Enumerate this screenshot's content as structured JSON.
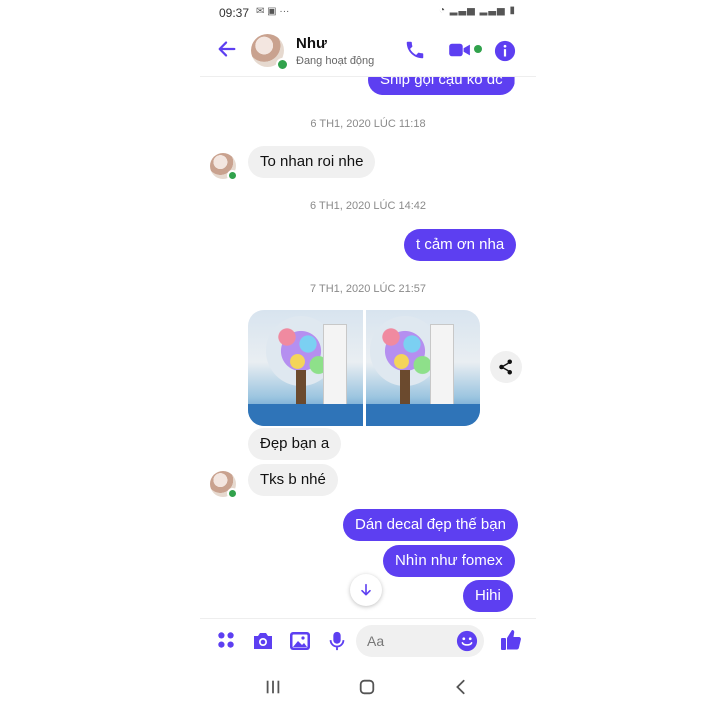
{
  "status_bar": {
    "time": "09:37"
  },
  "header": {
    "name": "Như",
    "status": "Đang hoạt động"
  },
  "messages": {
    "top_partial": "Ship gọi cậu ko dc",
    "ts1": "6 TH1, 2020 LÚC 11:18",
    "in1": "To nhan roi nhe",
    "ts2": "6 TH1, 2020 LÚC 14:42",
    "out1": "t cảm ơn nha",
    "ts3": "7 TH1, 2020 LÚC 21:57",
    "in2": "Đẹp bạn a",
    "in3": "Tks b nhé",
    "out2": "Dán decal đẹp thế bạn",
    "out3": "Nhìn như fomex",
    "out4": "Hihi"
  },
  "composer": {
    "placeholder": "Aa"
  },
  "colors": {
    "accent": "#5d3ff1",
    "incoming_bubble": "#f0f0f0",
    "online": "#31a24c"
  },
  "icons": [
    "back-arrow-icon",
    "phone-icon",
    "video-icon",
    "info-icon",
    "share-icon",
    "arrow-down-icon",
    "apps-icon",
    "camera-icon",
    "gallery-icon",
    "mic-icon",
    "emoji-icon",
    "thumbs-up-icon",
    "recent-apps-icon",
    "home-icon",
    "back-nav-icon"
  ]
}
